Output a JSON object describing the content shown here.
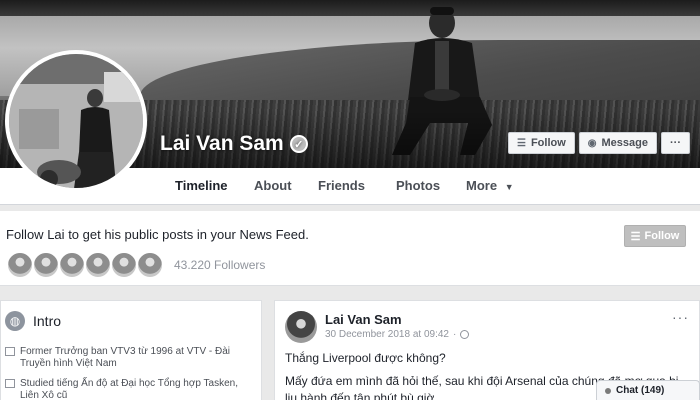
{
  "profile": {
    "name": "Lai Van Sam",
    "verified_icon": "verified-check-icon"
  },
  "cover_actions": {
    "follow_label": "Follow",
    "message_label": "Message",
    "more_label": "···"
  },
  "nav": {
    "tabs": [
      {
        "label": "Timeline",
        "active": true
      },
      {
        "label": "About"
      },
      {
        "label": "Friends"
      },
      {
        "label": "Photos"
      },
      {
        "label": "More"
      }
    ]
  },
  "banner": {
    "prefix": "Follow",
    "name": "Lai",
    "suffix": "to get his public posts in your News Feed.",
    "follow_label": "Follow",
    "followers": "43.220 Followers"
  },
  "intro": {
    "title": "Intro",
    "items": [
      {
        "text": "Former Trưởng ban VTV3 từ 1996 at",
        "link": "VTV - Đài Truyền hình Việt Nam"
      },
      {
        "text": "Studied tiếng Ấn độ at",
        "link": "Đại học Tổng hợp Tasken, Liên Xô cũ"
      }
    ]
  },
  "post": {
    "author": "Lai Van Sam",
    "timestamp": "30 December 2018 at 09:42",
    "line1": "Thắng Liverpool được không?",
    "line2": "Mấy đứa em mình đã hỏi thế, sau khi đội Arsenal của chúng đã mơ qua bị lịu hành đến tận phút bù giờ.",
    "more": "···"
  },
  "chat": {
    "label": "Chat (149)"
  }
}
